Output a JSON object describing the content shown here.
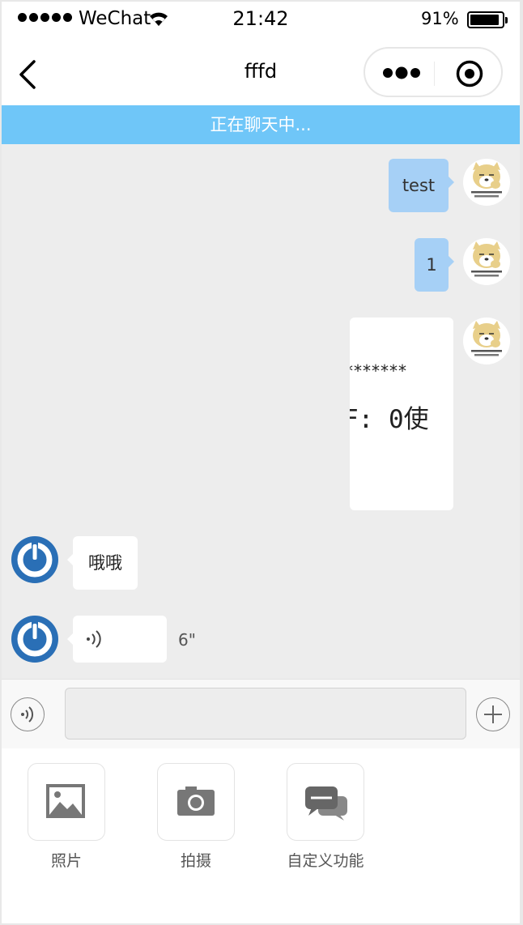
{
  "status_bar": {
    "carrier": "WeChat",
    "time": "21:42",
    "battery": "91%",
    "battery_level": 0.91
  },
  "nav": {
    "title": "fffd"
  },
  "banner": {
    "text": "正在聊天中..."
  },
  "messages": [
    {
      "side": "right",
      "type": "text",
      "text": "test"
    },
    {
      "side": "right",
      "type": "text",
      "text": "1"
    },
    {
      "side": "right",
      "type": "image",
      "image_text_line1": "*******",
      "image_text_line2": "F: 0使"
    },
    {
      "side": "left",
      "type": "text",
      "text": "哦哦"
    },
    {
      "side": "left",
      "type": "voice",
      "duration": "6\""
    }
  ],
  "avatar_caption": "心の中にちょっと\n弱音があるの?",
  "tools": [
    {
      "label": "照片",
      "icon": "photo-icon"
    },
    {
      "label": "拍摄",
      "icon": "camera-icon"
    },
    {
      "label": "自定义功能",
      "icon": "chat-bubbles-icon"
    }
  ],
  "colors": {
    "banner": "#6fc6f8",
    "my_bubble": "#a6d0f6",
    "chat_bg": "#ededed",
    "other_avatar": "#2a6fb6"
  }
}
